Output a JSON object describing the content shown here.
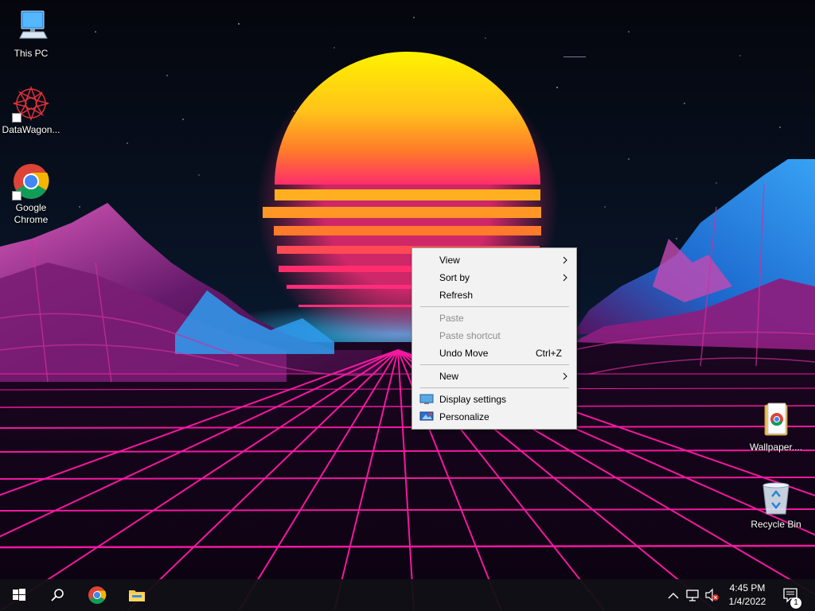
{
  "desktop_icons": [
    {
      "label": "This PC",
      "icon": "computer-icon"
    },
    {
      "label": "DataWagon...",
      "icon": "datawagon-app-icon"
    },
    {
      "label": "Google Chrome",
      "icon": "chrome-icon"
    },
    {
      "label": "Wallpaper....",
      "icon": "folder-chrome-file-icon"
    },
    {
      "label": "Recycle Bin",
      "icon": "recycle-bin-icon"
    }
  ],
  "context_menu": {
    "items": [
      {
        "label": "View",
        "enabled": true,
        "submenu": true
      },
      {
        "label": "Sort by",
        "enabled": true,
        "submenu": true
      },
      {
        "label": "Refresh",
        "enabled": true
      },
      {
        "label": "Paste",
        "enabled": false
      },
      {
        "label": "Paste shortcut",
        "enabled": false
      },
      {
        "label": "Undo Move",
        "enabled": true,
        "accelerator": "Ctrl+Z"
      },
      {
        "label": "New",
        "enabled": true,
        "submenu": true
      },
      {
        "label": "Display settings",
        "enabled": true,
        "icon": "display-settings-icon"
      },
      {
        "label": "Personalize",
        "enabled": true,
        "icon": "personalize-icon"
      }
    ]
  },
  "taskbar": {
    "pinned": [
      "start-icon",
      "search-icon",
      "chrome-icon",
      "file-explorer-icon"
    ],
    "tray_icons": [
      "chevron-up-icon",
      "network-icon",
      "volume-muted-icon"
    ],
    "clock": {
      "time": "4:45 PM",
      "date": "1/4/2022"
    },
    "notifications": {
      "count": "1"
    }
  },
  "colors": {
    "sun_top": "#ffee00",
    "sun_bottom": "#ff2d6b",
    "grid": "#ff1aa6",
    "mountain": "#2fa8ff",
    "menu_bg": "#f2f2f2"
  }
}
